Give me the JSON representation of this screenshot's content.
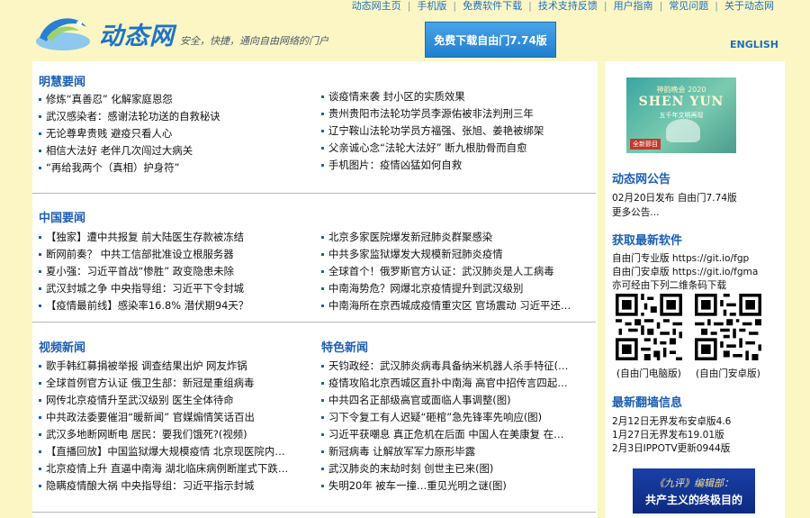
{
  "header": {
    "logo_text": "动态网",
    "tagline": "安全，快捷，通向自由网络的门户",
    "download_button": "免费下载自由门7.74版",
    "english_link": "ENGLISH",
    "top_links": [
      "动态网主页",
      "手机版",
      "免费软件下载",
      "技术支持反馈",
      "用户指南",
      "常见问题",
      "关于动态网"
    ]
  },
  "minghui": {
    "title": "明慧要闻",
    "left": [
      "修炼“真善忍” 化解家庭恩怨",
      "武汉感染者：感谢法轮功送的自救秘诀",
      "无论尊卑贵贱 避疫只看人心",
      "相信大法好 老伴几次闯过大病关",
      "“再给我两个（真相）护身符”"
    ],
    "right": [
      "谈疫情来袭 封小区的实质效果",
      "贵州贵阳市法轮功学员李源佑被非法判刑三年",
      "辽宁鞍山法轮功学员方福强、张旭、姜艳被绑架",
      "父亲诚心念“法轮大法好” 断九根肋骨而自愈",
      "手机图片：疫情凶猛如何自救"
    ]
  },
  "china": {
    "title": "中国要闻",
    "left": [
      "【独家】遭中共报复 前大陆医生存款被冻结",
      "断网前奏？ 中共工信部批准设立根服务器",
      "夏小强：习近平首战“惨胜” 政变隐患未除",
      "武汉封城之争 中央指导组：习近平下令封城",
      "【疫情最前线】感染率16.8% 潜伏期94天？"
    ],
    "right": [
      "北京多家医院爆发新冠肺炎群聚感染",
      "中共多家监狱爆发大规模新冠肺炎疫情",
      "全球首个！俄罗斯官方认证：武汉肺炎是人工病毒",
      "中南海势危？网爆北京疫情提升到武汉级别",
      "中南海所在京西城成疫情重灾区 官场震动 习近平还…"
    ]
  },
  "video": {
    "title": "视频新闻",
    "items": [
      "歌手韩红募捐被举报 调查结果出炉 网友炸锅",
      "全球首例官方认证 俄卫生部：新冠是重组病毒",
      "网传北京疫情升至武汉级别 医生全体待命",
      "中共政法委要催泪“暖新闻” 官媒煽情笑话百出",
      "武汉多地断网断电 居民：要我们饿死?(视频)",
      "【直播回放】中国监狱爆大规模疫情 北京现医院内…",
      "北京疫情上升 直逼中南海 湖北临床病例断崖式下跌…",
      "隐瞒疫情酿大祸 中央指导组：习近平指示封城"
    ]
  },
  "featured": {
    "title": "特色新闻",
    "items": [
      "天钧政经：武汉肺炎病毒具备纳米机器人杀手特征(…",
      "疫情攻陷北京西城区直扑中南海 高官中招传言四起…",
      "中共四名正部级高官或面临人事调整(图)",
      "习下令复工有人迟疑“砸棺”急先锋率先响应(图)",
      "习近平获嘲息 真正危机在后面 中国人在美康复 在…",
      "新冠病毒 让解放军军力原形毕露",
      "武汉肺炎的末劫时刻 创世主已来(图)",
      "失明20年 被车一撞…重见光明之谜(图)"
    ]
  },
  "sidebar": {
    "promo": {
      "line1": "神韵晚会 2020",
      "line2": "SHEN YUN",
      "line3": "五千年文明再现",
      "badge": "全新節目"
    },
    "announce_title": "动态网公告",
    "announce": [
      "02月20日发布 自由门7.74版",
      "更多公告..."
    ],
    "software_title": "获取最新软件",
    "software": [
      "自由门专业版 https://git.io/fgp",
      "自由门安卓版 https://git.io/fgma",
      "亦可经由下列二维条码下载"
    ],
    "qr_pc_caption": "(自由门电脑版)",
    "qr_android_caption": "(自由门安卓版)",
    "wall_title": "最新翻墙信息",
    "wall": [
      "2月12日无界发布安卓版4.6",
      "1月27日无界发布19.01版",
      "2月3日IPPOTV更新0944版"
    ],
    "promo2": {
      "line1": "《九评》编辑部：",
      "line2": "共产主义的终极目的"
    }
  },
  "colors": {
    "background": "#fbf6c4",
    "link_blue": "#1d5fb4",
    "button_blue": "#1f7fd0"
  }
}
